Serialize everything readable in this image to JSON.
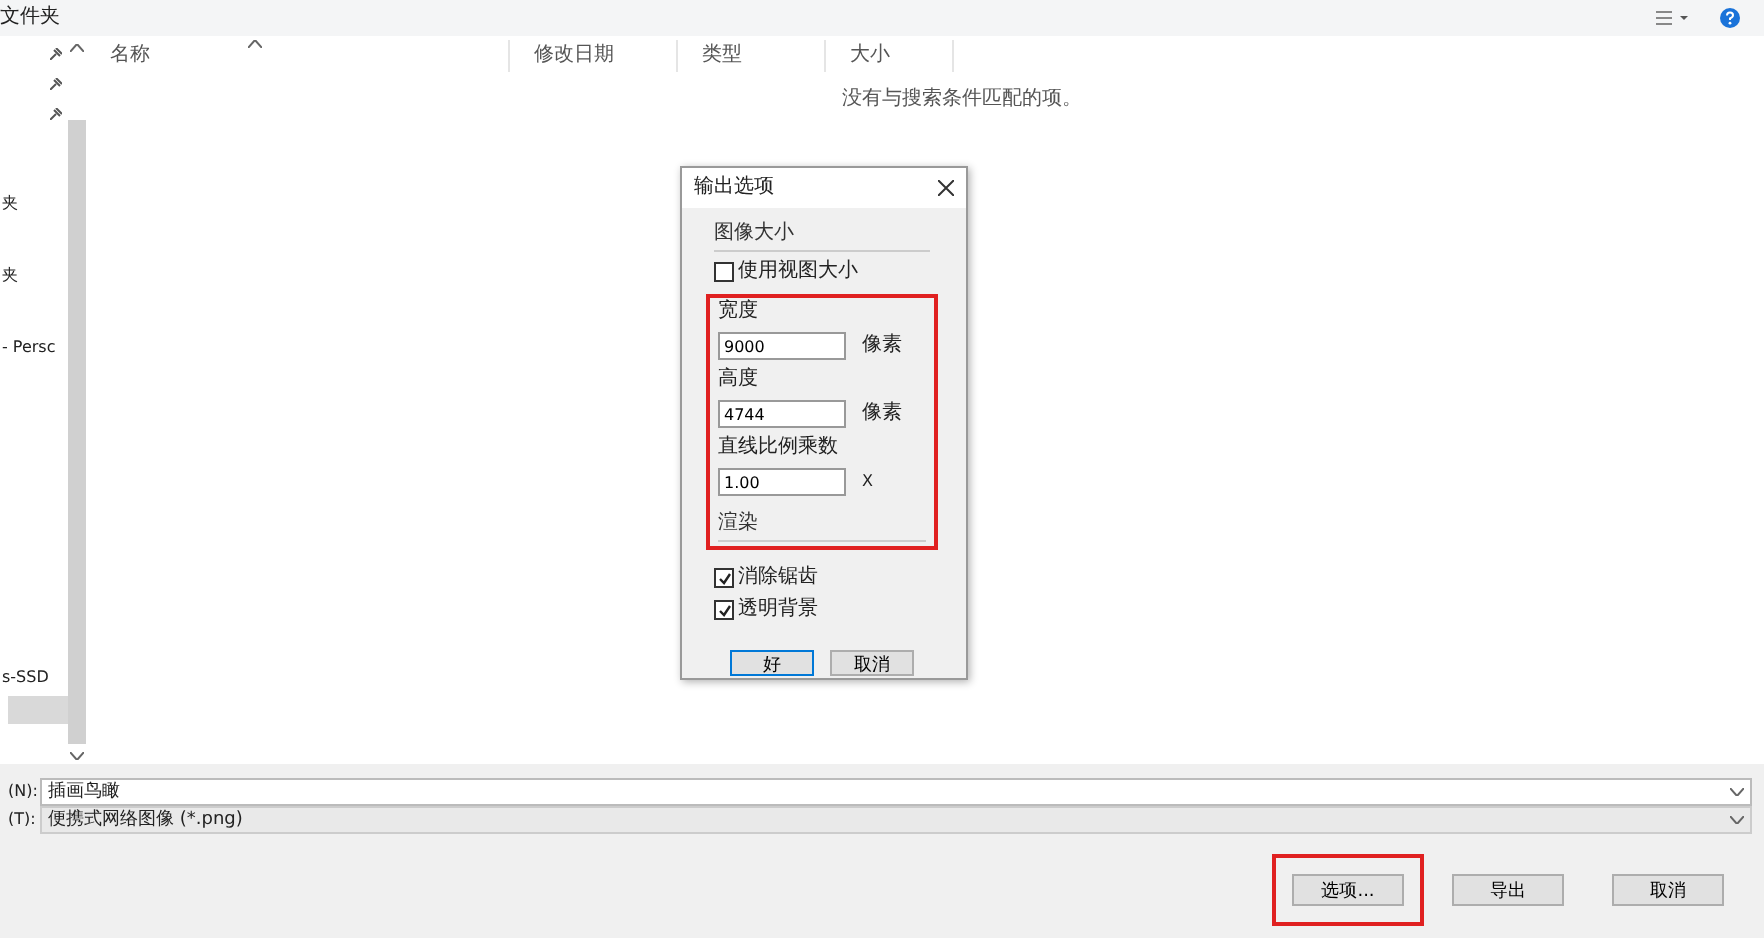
{
  "address_bar": {
    "text": "文件夹"
  },
  "nav_pane": {
    "items": [
      {
        "label": "夹"
      },
      {
        "label": "夹"
      },
      {
        "label": "- Persc"
      },
      {
        "label": "s-SSD"
      }
    ]
  },
  "file_list": {
    "columns": [
      "名称",
      "修改日期",
      "类型",
      "大小"
    ],
    "empty_message": "没有与搜索条件匹配的项。"
  },
  "file_name": {
    "label": "(N):",
    "value": "插画鸟瞰"
  },
  "file_type": {
    "label": "(T):",
    "value": "便携式网络图像 (*.png)"
  },
  "buttons": [
    {
      "label": "选项...",
      "highlighted": true
    },
    {
      "label": "导出",
      "highlighted": false
    },
    {
      "label": "取消",
      "highlighted": false
    }
  ],
  "options_dialog": {
    "title": "输出选项",
    "section_size": "图像大小",
    "use_view_size": {
      "label": "使用视图大小",
      "checked": false
    },
    "fields": [
      {
        "label": "宽度",
        "value": "9000",
        "unit": "像素"
      },
      {
        "label": "高度",
        "value": "4744",
        "unit": "像素"
      },
      {
        "label": "直线比例乘数",
        "value": "1.00",
        "unit": "X"
      }
    ],
    "fields_highlighted": true,
    "section_render": "渲染",
    "render_options": [
      {
        "label": "消除锯齿",
        "checked": true
      },
      {
        "label": "透明背景",
        "checked": true
      }
    ],
    "ok": "好",
    "cancel": "取消"
  }
}
